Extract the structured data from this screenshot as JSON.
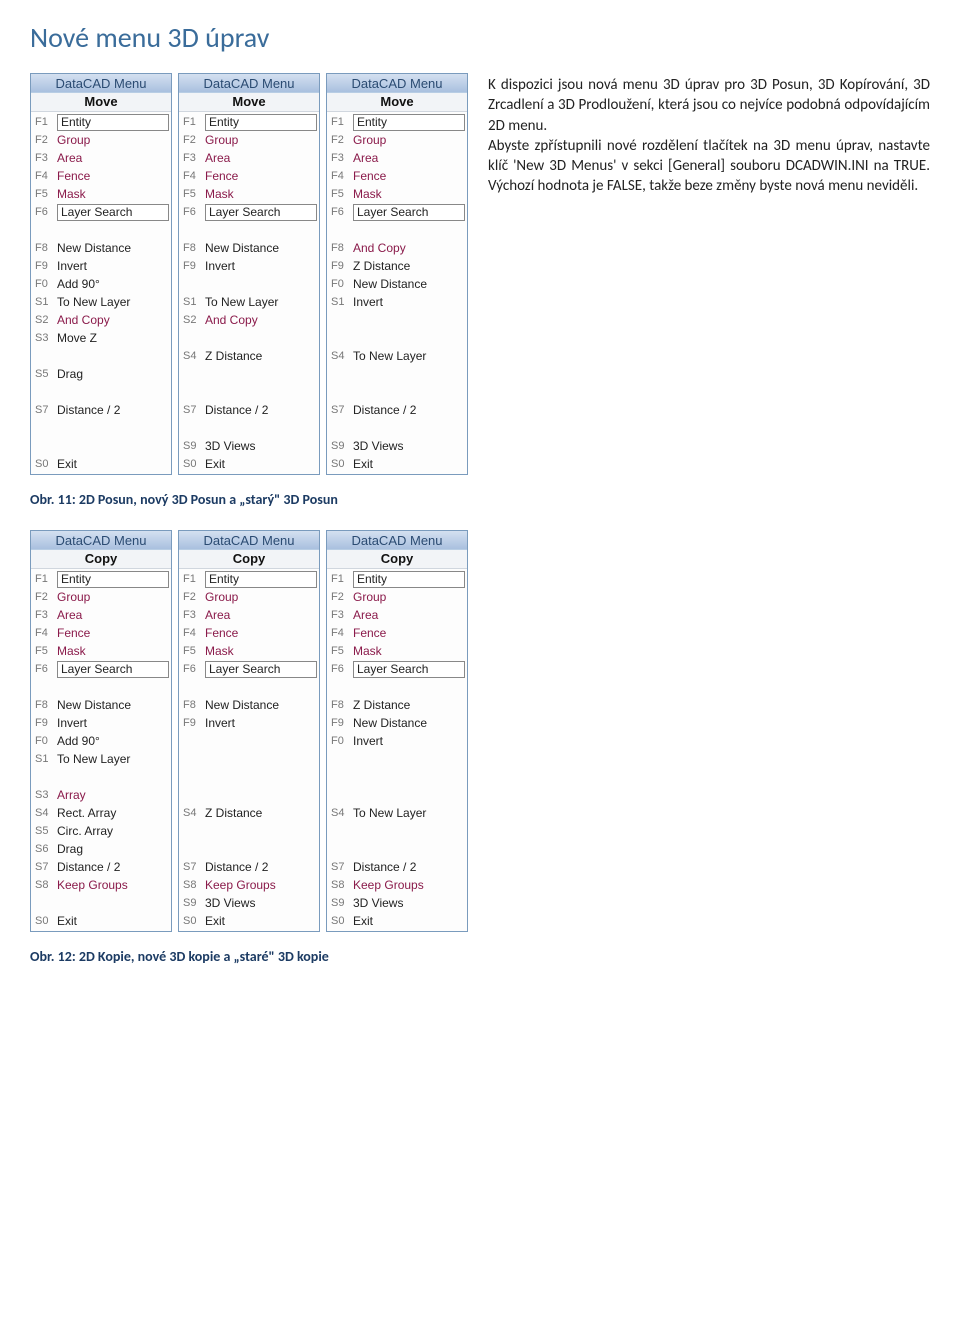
{
  "heading": "Nové menu 3D úprav",
  "paragraph": "K dispozici jsou nová menu 3D úprav pro 3D Posun, 3D Kopírování, 3D Zrcadlení a 3D Prodloužení, která jsou co nejvíce podobná odpovídajícím 2D menu.\nAbyste zpřístupnili nové rozdělení tlačítek na 3D menu úprav, nastavte klíč 'New 3D Menus' v sekci [General] souboru DCADWIN.INI na TRUE. Výchozí hodnota je FALSE, takže beze změny byste nová menu neviděli.",
  "caption1": "Obr. 11: 2D Posun, nový 3D Posun a „starý\" 3D Posun",
  "caption2": "Obr. 12: 2D Kopie, nové 3D kopie a „staré\" 3D kopie",
  "menu_header": "DataCAD Menu",
  "groups": {
    "move": {
      "sub": "Move",
      "panels": [
        [
          {
            "k": "F1",
            "l": "Entity",
            "b": true
          },
          {
            "k": "F2",
            "l": "Group",
            "a": true
          },
          {
            "k": "F3",
            "l": "Area",
            "a": true
          },
          {
            "k": "F4",
            "l": "Fence",
            "a": true
          },
          {
            "k": "F5",
            "l": "Mask",
            "a": true
          },
          {
            "k": "F6",
            "l": "Layer Search",
            "b": true
          },
          {
            "k": "",
            "l": ""
          },
          {
            "k": "F8",
            "l": "New Distance"
          },
          {
            "k": "F9",
            "l": "Invert"
          },
          {
            "k": "F0",
            "l": "Add 90°"
          },
          {
            "k": "S1",
            "l": "To New Layer"
          },
          {
            "k": "S2",
            "l": "And Copy",
            "a": true
          },
          {
            "k": "S3",
            "l": "Move Z"
          },
          {
            "k": "",
            "l": ""
          },
          {
            "k": "S5",
            "l": "Drag"
          },
          {
            "k": "",
            "l": ""
          },
          {
            "k": "S7",
            "l": "Distance / 2"
          },
          {
            "k": "",
            "l": ""
          },
          {
            "k": "",
            "l": ""
          },
          {
            "k": "S0",
            "l": "Exit"
          }
        ],
        [
          {
            "k": "F1",
            "l": "Entity",
            "b": true
          },
          {
            "k": "F2",
            "l": "Group",
            "a": true
          },
          {
            "k": "F3",
            "l": "Area",
            "a": true
          },
          {
            "k": "F4",
            "l": "Fence",
            "a": true
          },
          {
            "k": "F5",
            "l": "Mask",
            "a": true
          },
          {
            "k": "F6",
            "l": "Layer Search",
            "b": true
          },
          {
            "k": "",
            "l": ""
          },
          {
            "k": "F8",
            "l": "New Distance"
          },
          {
            "k": "F9",
            "l": "Invert"
          },
          {
            "k": "",
            "l": ""
          },
          {
            "k": "S1",
            "l": "To New Layer"
          },
          {
            "k": "S2",
            "l": "And Copy",
            "a": true
          },
          {
            "k": "",
            "l": ""
          },
          {
            "k": "S4",
            "l": "Z Distance"
          },
          {
            "k": "",
            "l": ""
          },
          {
            "k": "",
            "l": ""
          },
          {
            "k": "S7",
            "l": "Distance / 2"
          },
          {
            "k": "",
            "l": ""
          },
          {
            "k": "S9",
            "l": "3D Views"
          },
          {
            "k": "S0",
            "l": "Exit"
          }
        ],
        [
          {
            "k": "F1",
            "l": "Entity",
            "b": true
          },
          {
            "k": "F2",
            "l": "Group",
            "a": true
          },
          {
            "k": "F3",
            "l": "Area",
            "a": true
          },
          {
            "k": "F4",
            "l": "Fence",
            "a": true
          },
          {
            "k": "F5",
            "l": "Mask",
            "a": true
          },
          {
            "k": "F6",
            "l": "Layer Search",
            "b": true
          },
          {
            "k": "",
            "l": ""
          },
          {
            "k": "F8",
            "l": "And Copy",
            "a": true
          },
          {
            "k": "F9",
            "l": "Z Distance"
          },
          {
            "k": "F0",
            "l": "New Distance"
          },
          {
            "k": "S1",
            "l": "Invert"
          },
          {
            "k": "",
            "l": ""
          },
          {
            "k": "",
            "l": ""
          },
          {
            "k": "S4",
            "l": "To New Layer"
          },
          {
            "k": "",
            "l": ""
          },
          {
            "k": "",
            "l": ""
          },
          {
            "k": "S7",
            "l": "Distance / 2"
          },
          {
            "k": "",
            "l": ""
          },
          {
            "k": "S9",
            "l": "3D Views"
          },
          {
            "k": "S0",
            "l": "Exit"
          }
        ]
      ]
    },
    "copy": {
      "sub": "Copy",
      "panels": [
        [
          {
            "k": "F1",
            "l": "Entity",
            "b": true
          },
          {
            "k": "F2",
            "l": "Group",
            "a": true
          },
          {
            "k": "F3",
            "l": "Area",
            "a": true
          },
          {
            "k": "F4",
            "l": "Fence",
            "a": true
          },
          {
            "k": "F5",
            "l": "Mask",
            "a": true
          },
          {
            "k": "F6",
            "l": "Layer Search",
            "b": true
          },
          {
            "k": "",
            "l": ""
          },
          {
            "k": "F8",
            "l": "New Distance"
          },
          {
            "k": "F9",
            "l": "Invert"
          },
          {
            "k": "F0",
            "l": "Add 90°"
          },
          {
            "k": "S1",
            "l": "To New Layer"
          },
          {
            "k": "",
            "l": ""
          },
          {
            "k": "S3",
            "l": "Array",
            "a": true
          },
          {
            "k": "S4",
            "l": "Rect. Array"
          },
          {
            "k": "S5",
            "l": "Circ. Array"
          },
          {
            "k": "S6",
            "l": "Drag"
          },
          {
            "k": "S7",
            "l": "Distance / 2"
          },
          {
            "k": "S8",
            "l": "Keep Groups",
            "a": true
          },
          {
            "k": "",
            "l": ""
          },
          {
            "k": "S0",
            "l": "Exit"
          }
        ],
        [
          {
            "k": "F1",
            "l": "Entity",
            "b": true
          },
          {
            "k": "F2",
            "l": "Group",
            "a": true
          },
          {
            "k": "F3",
            "l": "Area",
            "a": true
          },
          {
            "k": "F4",
            "l": "Fence",
            "a": true
          },
          {
            "k": "F5",
            "l": "Mask",
            "a": true
          },
          {
            "k": "F6",
            "l": "Layer Search",
            "b": true
          },
          {
            "k": "",
            "l": ""
          },
          {
            "k": "F8",
            "l": "New Distance"
          },
          {
            "k": "F9",
            "l": "Invert"
          },
          {
            "k": "",
            "l": ""
          },
          {
            "k": "",
            "l": ""
          },
          {
            "k": "",
            "l": ""
          },
          {
            "k": "",
            "l": ""
          },
          {
            "k": "S4",
            "l": "Z Distance"
          },
          {
            "k": "",
            "l": ""
          },
          {
            "k": "",
            "l": ""
          },
          {
            "k": "S7",
            "l": "Distance / 2"
          },
          {
            "k": "S8",
            "l": "Keep Groups",
            "a": true
          },
          {
            "k": "S9",
            "l": "3D Views"
          },
          {
            "k": "S0",
            "l": "Exit"
          }
        ],
        [
          {
            "k": "F1",
            "l": "Entity",
            "b": true
          },
          {
            "k": "F2",
            "l": "Group",
            "a": true
          },
          {
            "k": "F3",
            "l": "Area",
            "a": true
          },
          {
            "k": "F4",
            "l": "Fence",
            "a": true
          },
          {
            "k": "F5",
            "l": "Mask",
            "a": true
          },
          {
            "k": "F6",
            "l": "Layer Search",
            "b": true
          },
          {
            "k": "",
            "l": ""
          },
          {
            "k": "F8",
            "l": "Z Distance"
          },
          {
            "k": "F9",
            "l": "New Distance"
          },
          {
            "k": "F0",
            "l": "Invert"
          },
          {
            "k": "",
            "l": ""
          },
          {
            "k": "",
            "l": ""
          },
          {
            "k": "",
            "l": ""
          },
          {
            "k": "S4",
            "l": "To New Layer"
          },
          {
            "k": "",
            "l": ""
          },
          {
            "k": "",
            "l": ""
          },
          {
            "k": "S7",
            "l": "Distance / 2"
          },
          {
            "k": "S8",
            "l": "Keep Groups",
            "a": true
          },
          {
            "k": "S9",
            "l": "3D Views"
          },
          {
            "k": "S0",
            "l": "Exit"
          }
        ]
      ]
    }
  }
}
